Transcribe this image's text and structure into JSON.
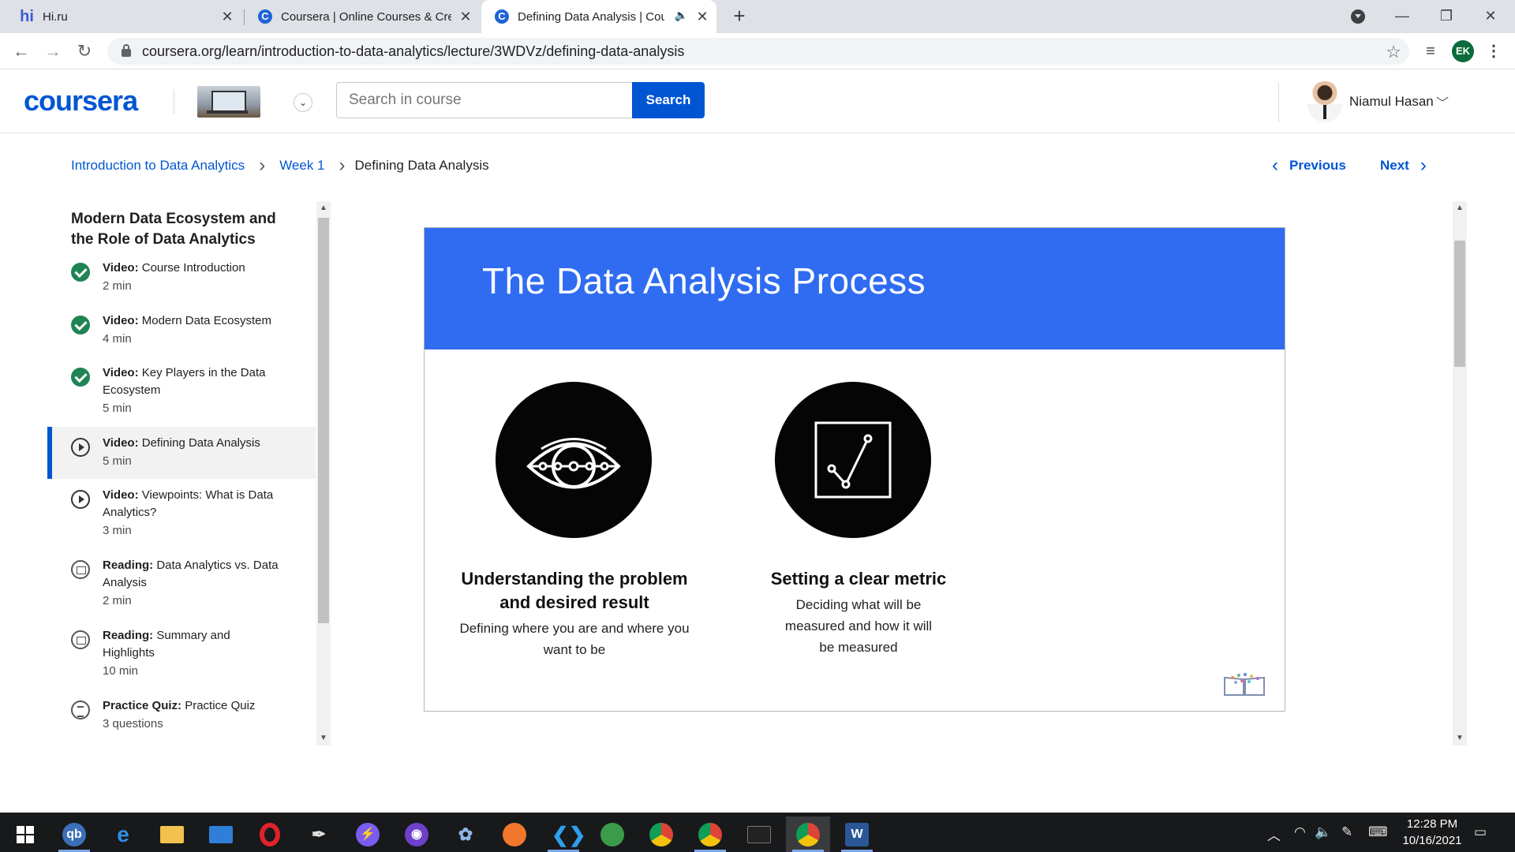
{
  "browser": {
    "tabs": [
      {
        "title": "Hi.ru",
        "favicon": "hi-favicon",
        "active": false
      },
      {
        "title": "Coursera | Online Courses & Cred",
        "favicon": "coursera-favicon",
        "active": false
      },
      {
        "title": "Defining Data Analysis | Cou",
        "favicon": "coursera-favicon",
        "active": true,
        "audio": true
      }
    ],
    "url": "coursera.org/learn/introduction-to-data-analytics/lecture/3WDVz/defining-data-analysis",
    "profile_initials": "EK"
  },
  "header": {
    "logo": "coursera",
    "search_placeholder": "Search in course",
    "search_button": "Search",
    "user_name": "Niamul Hasan"
  },
  "breadcrumb": {
    "course": "Introduction to Data Analytics",
    "week": "Week 1",
    "current": "Defining Data Analysis"
  },
  "nav": {
    "previous": "Previous",
    "next": "Next"
  },
  "sidebar": {
    "module_title": "Modern Data Ecosystem and the Role of Data Analytics",
    "items": [
      {
        "type": "Video:",
        "title": "Course Introduction",
        "meta": "2 min",
        "status": "completed"
      },
      {
        "type": "Video:",
        "title": "Modern Data Ecosystem",
        "meta": "4 min",
        "status": "completed"
      },
      {
        "type": "Video:",
        "title": "Key Players in the Data Ecosystem",
        "meta": "5 min",
        "status": "completed"
      },
      {
        "type": "Video:",
        "title": "Defining Data Analysis",
        "meta": "5 min",
        "status": "current"
      },
      {
        "type": "Video:",
        "title": "Viewpoints: What is Data Analytics?",
        "meta": "3 min",
        "status": "video"
      },
      {
        "type": "Reading:",
        "title": "Data Analytics vs. Data Analysis",
        "meta": "2 min",
        "status": "reading"
      },
      {
        "type": "Reading:",
        "title": "Summary and Highlights",
        "meta": "10 min",
        "status": "reading"
      },
      {
        "type": "Practice Quiz:",
        "title": "Practice Quiz",
        "meta": "3 questions",
        "status": "quiz"
      }
    ]
  },
  "slide": {
    "title": "The Data Analysis Process",
    "steps": [
      {
        "title": "Understanding the problem and desired result",
        "description": "Defining where you are and where you want to be",
        "icon": "eye-icon"
      },
      {
        "title": "Setting a clear metric",
        "description": "Deciding what will be measured and how it will be measured",
        "icon": "chart-metric-icon"
      }
    ]
  },
  "taskbar": {
    "time": "12:28 PM",
    "date": "10/16/2021"
  },
  "colors": {
    "coursera_blue": "#0056d2",
    "slide_header": "#2f6cf2",
    "completed_green": "#1f8354"
  }
}
